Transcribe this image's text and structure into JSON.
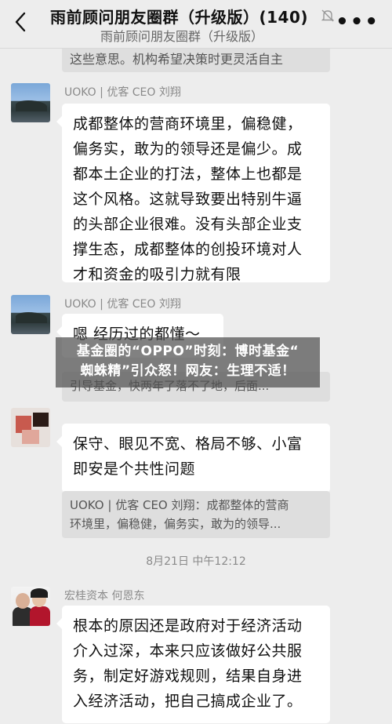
{
  "header": {
    "title": "雨前顾问朋友圈群（升级版）(140)",
    "subtitle": "雨前顾问朋友圈群（升级版）",
    "back_icon": "chevron-left-icon",
    "mute_icon": "bell-muted-icon",
    "more_icon": "more-dots-icon",
    "more_label": "•••"
  },
  "messages": {
    "prev_tail": "这些意思。机构希望决策时更灵活自主",
    "msg1": {
      "sender": "UOKO | 优客 CEO 刘翔",
      "lines": [
        "成都整体的营商环境里，偏稳健，",
        "偏务实，敢为的领导还是偏少。成",
        "都本土企业的打法，整体上也都是",
        "这个风格。这就导致要出特别牛逼",
        "的头部企业很难。没有头部企业支",
        "撑生态，成都整体的创投环境对人",
        "才和资金的吸引力就有限"
      ]
    },
    "msg2": {
      "sender": "UOKO | 优客 CEO 刘翔",
      "line1": "嗯 经历过的都懂～",
      "quote_tail": "引导基金，快两年了落不了地，后面..."
    },
    "msg3": {
      "lines": [
        "保守、眼见不宽、格局不够、小富",
        "即安是个共性问题"
      ],
      "quote_lines": [
        "UOKO | 优客 CEO 刘翔：成都整体的营商",
        "环境里，偏稳健，偏务实，敢为的领导..."
      ]
    },
    "timestamp": "8月21日 中午12:12",
    "msg4": {
      "sender": "宏桂资本 何恩东",
      "lines": [
        "根本的原因还是政府对于经济活动",
        "介入过深，本来只应该做好公共服",
        "务，制定好游戏规则，结果自身进",
        "入经济活动，把自己搞成企业了。"
      ]
    }
  },
  "overlay": {
    "line1": "基金圈的“OPPO”时刻：博时基金“",
    "line2": "蜘蛛精”引众怒！网友：生理不适！"
  }
}
